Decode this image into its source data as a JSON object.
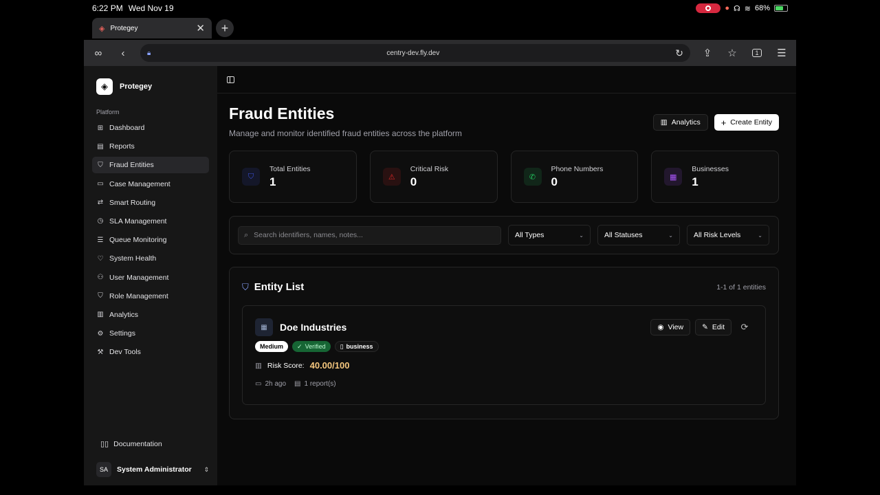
{
  "status_bar": {
    "time": "6:22 PM",
    "date": "Wed Nov 19",
    "battery": "68%",
    "battery_level": 0.68
  },
  "browser": {
    "tab_title": "Protegey",
    "url": "centry-dev.fly.dev",
    "tab_count": "1"
  },
  "sidebar": {
    "brand": "Protegey",
    "section": "Platform",
    "items": [
      {
        "label": "Dashboard",
        "icon": "grid-icon"
      },
      {
        "label": "Reports",
        "icon": "file-icon"
      },
      {
        "label": "Fraud Entities",
        "icon": "shield-icon",
        "active": true
      },
      {
        "label": "Case Management",
        "icon": "folder-icon"
      },
      {
        "label": "Smart Routing",
        "icon": "route-icon"
      },
      {
        "label": "SLA Management",
        "icon": "clock-icon"
      },
      {
        "label": "Queue Monitoring",
        "icon": "list-icon"
      },
      {
        "label": "System Health",
        "icon": "heart-icon"
      },
      {
        "label": "User Management",
        "icon": "users-icon"
      },
      {
        "label": "Role Management",
        "icon": "shield-icon"
      },
      {
        "label": "Analytics",
        "icon": "bar-chart-icon"
      },
      {
        "label": "Settings",
        "icon": "gear-icon"
      },
      {
        "label": "Dev Tools",
        "icon": "wrench-icon"
      }
    ],
    "documentation": "Documentation",
    "user_initials": "SA",
    "user_name": "System Administrator"
  },
  "page": {
    "title": "Fraud Entities",
    "subtitle": "Manage and monitor identified fraud entities across the platform",
    "analytics_label": "Analytics",
    "create_label": "Create Entity"
  },
  "stats": [
    {
      "label": "Total Entities",
      "value": "1",
      "color": "#3b4fd8",
      "icon": "shield-icon"
    },
    {
      "label": "Critical Risk",
      "value": "0",
      "color": "#dc2626",
      "icon": "alert-icon"
    },
    {
      "label": "Phone Numbers",
      "value": "0",
      "color": "#22c55e",
      "icon": "phone-icon"
    },
    {
      "label": "Businesses",
      "value": "1",
      "color": "#a855f7",
      "icon": "building-icon"
    }
  ],
  "filters": {
    "search_placeholder": "Search identifiers, names, notes...",
    "types": "All Types",
    "statuses": "All Statuses",
    "risk_levels": "All Risk Levels"
  },
  "entity_list": {
    "title": "Entity List",
    "count": "1-1 of 1 entities",
    "entities": [
      {
        "name": "Doe Industries",
        "risk_badge": "Medium",
        "status_badge": "Verified",
        "type_badge": "business",
        "risk_score_label": "Risk Score:",
        "risk_score": "40.00/100",
        "time": "2h ago",
        "reports": "1 report(s)",
        "view_label": "View",
        "edit_label": "Edit"
      }
    ]
  }
}
